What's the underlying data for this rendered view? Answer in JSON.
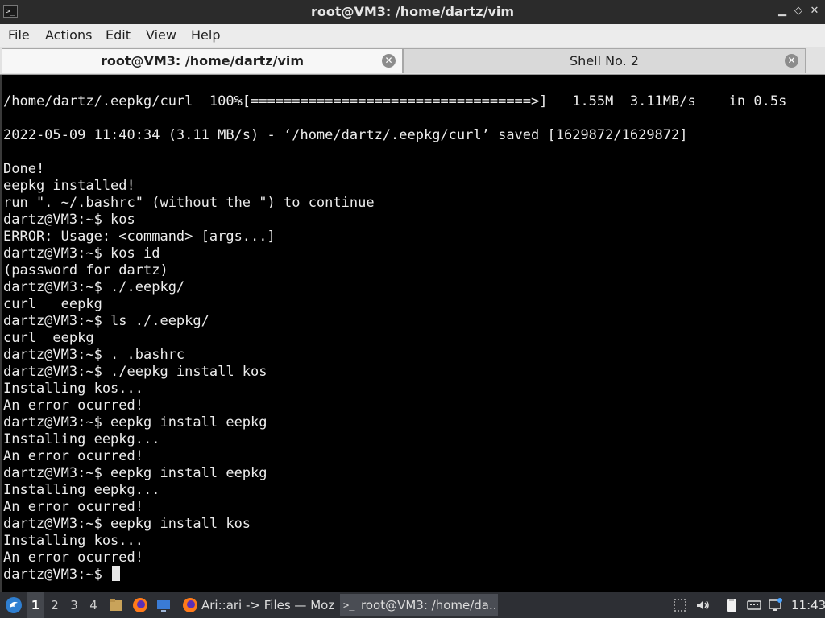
{
  "window": {
    "title": "root@VM3: /home/dartz/vim",
    "app_icon": ">_",
    "controls": {
      "minimize": "▁",
      "maximize": "◇",
      "close": "✕"
    }
  },
  "menu": {
    "items": [
      "File",
      "Actions",
      "Edit",
      "View",
      "Help"
    ]
  },
  "tabs": [
    {
      "label": "root@VM3: /home/dartz/vim",
      "active": true
    },
    {
      "label": "Shell No. 2",
      "active": false
    }
  ],
  "terminal": {
    "lines": [
      "/home/dartz/.eepkg/curl  100%[==================================>]   1.55M  3.11MB/s    in 0.5s",
      "",
      "2022-05-09 11:40:34 (3.11 MB/s) - ‘/home/dartz/.eepkg/curl’ saved [1629872/1629872]",
      "",
      "Done!",
      "eepkg installed!",
      "run \". ~/.bashrc\" (without the \") to continue",
      "dartz@VM3:~$ kos",
      "ERROR: Usage: <command> [args...]",
      "dartz@VM3:~$ kos id",
      "(password for dartz)",
      "dartz@VM3:~$ ./.eepkg/",
      "curl   eepkg",
      "dartz@VM3:~$ ls ./.eepkg/",
      "curl  eepkg",
      "dartz@VM3:~$ . .bashrc",
      "dartz@VM3:~$ ./eepkg install kos",
      "Installing kos...",
      "An error ocurred!",
      "dartz@VM3:~$ eepkg install eepkg",
      "Installing eepkg...",
      "An error ocurred!",
      "dartz@VM3:~$ eepkg install eepkg",
      "Installing eepkg...",
      "An error ocurred!",
      "dartz@VM3:~$ eepkg install kos",
      "Installing kos...",
      "An error ocurred!"
    ],
    "prompt": "dartz@VM3:~$ "
  },
  "taskbar": {
    "workspaces": [
      "1",
      "2",
      "3",
      "4"
    ],
    "active_workspace": "1",
    "tasks": [
      {
        "label": "Ari::ari -> Files — Mozi...",
        "icon": "firefox-icon"
      },
      {
        "label": "root@VM3: /home/da...",
        "icon": "terminal-icon"
      }
    ],
    "clock": "11:43"
  },
  "colors": {
    "terminal_bg": "#000000",
    "terminal_fg": "#ececec",
    "titlebar_bg": "#2b2b2b",
    "taskbar_bg": "#2d2f34"
  }
}
